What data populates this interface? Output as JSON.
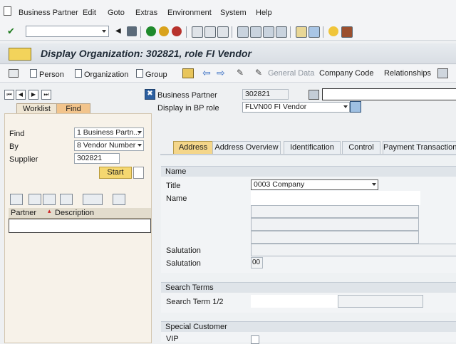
{
  "menu": [
    "Business Partner",
    "Edit",
    "Goto",
    "Extras",
    "Environment",
    "System",
    "Help"
  ],
  "page_title": "Display Organization: 302821, role FI Vendor",
  "app_toolbar": {
    "person": "Person",
    "organization": "Organization",
    "group": "Group",
    "general_data": "General Data",
    "company_code": "Company Code",
    "relationships": "Relationships"
  },
  "left": {
    "tabs": [
      "Worklist",
      "Find"
    ],
    "find_label": "Find",
    "find_value": "1 Business Partn...",
    "by_label": "By",
    "by_value": "8 Vendor Number",
    "supplier_label": "Supplier",
    "supplier_value": "302821",
    "start_label": "Start",
    "hitlist_cols": [
      "Partner",
      "Description"
    ]
  },
  "header": {
    "bp_label": "Business Partner",
    "bp_value": "302821",
    "role_label": "Display in BP role",
    "role_value": "FLVN00 FI Vendor"
  },
  "main_tabs": [
    "Address",
    "Address Overview",
    "Identification",
    "Control",
    "Payment Transaction"
  ],
  "name_group": {
    "title": "Name",
    "title_label": "Title",
    "title_value": "0003 Company",
    "name_label": "Name",
    "salutation_label": "Salutation",
    "salutation2_label": "Salutation",
    "salutation2_value": "00"
  },
  "search_group": {
    "title": "Search Terms",
    "term_label": "Search Term 1/2"
  },
  "special_group": {
    "title": "Special Customer",
    "vip_label": "VIP"
  }
}
